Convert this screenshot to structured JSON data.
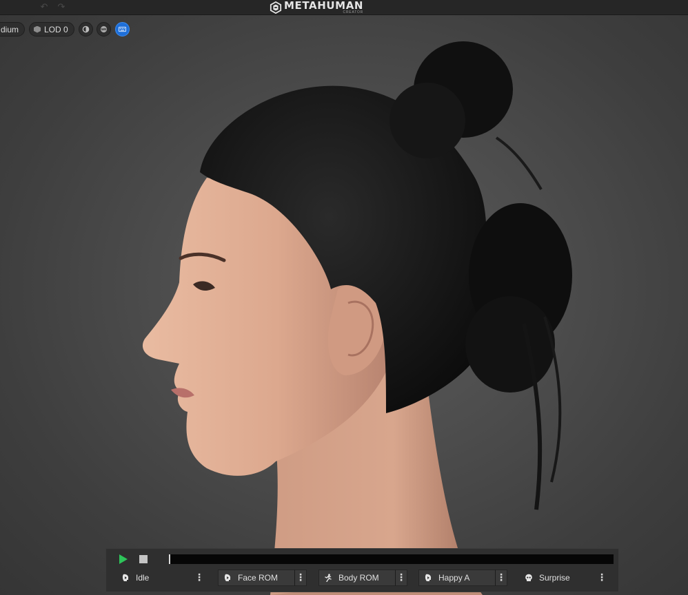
{
  "app": {
    "brand": "METAHUMAN",
    "brand_sub": "CREATOR"
  },
  "toolbar": {
    "undo_icon": "undo-icon",
    "redo_icon": "redo-icon"
  },
  "viewport": {
    "quality_label": "dium",
    "lod_label": "LOD 0",
    "buttons": [
      {
        "icon": "light-rig-icon",
        "active": false
      },
      {
        "icon": "background-icon",
        "active": false
      },
      {
        "icon": "keyboard-icon",
        "active": true
      }
    ]
  },
  "playback": {
    "play_icon": "play-icon",
    "stop_icon": "stop-icon",
    "progress": 0,
    "colors": {
      "play": "#2ec45a",
      "active_button": "#1e6fd9"
    },
    "animations": [
      {
        "label": "Idle",
        "icon": "face-icon"
      },
      {
        "label": "Face ROM",
        "icon": "face-icon"
      },
      {
        "label": "Body ROM",
        "icon": "running-figure-icon"
      },
      {
        "label": "Happy A",
        "icon": "face-icon"
      },
      {
        "label": "Surprise",
        "icon": "skull-icon"
      }
    ],
    "menu_glyph": "⋮"
  }
}
